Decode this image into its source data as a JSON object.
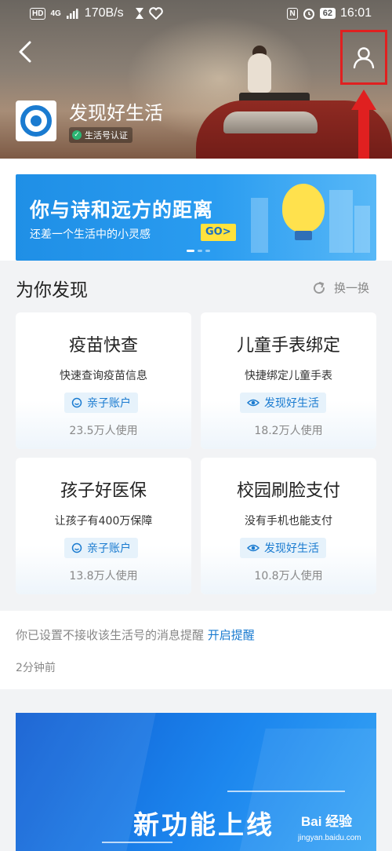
{
  "status_bar": {
    "network_chip": "HD",
    "network_type": "4G",
    "speed": "170B/s",
    "nfc": "N",
    "battery": "62",
    "time": "16:01"
  },
  "header": {
    "app_name": "发现好生活",
    "verify_label": "生活号认证"
  },
  "banner": {
    "title": "你与诗和远方的距离",
    "subtitle": "还差一个生活中的小灵感",
    "cta": "GO>"
  },
  "discover": {
    "title": "为你发现",
    "refresh_label": "换一换",
    "cards": [
      {
        "title": "疫苗快查",
        "desc": "快速查询疫苗信息",
        "tag": "亲子账户",
        "tag_icon": "smile-icon",
        "users": "23.5万人使用"
      },
      {
        "title": "儿童手表绑定",
        "desc": "快捷绑定儿童手表",
        "tag": "发现好生活",
        "tag_icon": "eye-icon",
        "users": "18.2万人使用"
      },
      {
        "title": "孩子好医保",
        "desc": "让孩子有400万保障",
        "tag": "亲子账户",
        "tag_icon": "smile-icon",
        "users": "13.8万人使用"
      },
      {
        "title": "校园刷脸支付",
        "desc": "没有手机也能支付",
        "tag": "发现好生活",
        "tag_icon": "eye-icon",
        "users": "10.8万人使用"
      }
    ]
  },
  "notice": {
    "text": "你已设置不接收该生活号的消息提醒",
    "link": "开启提醒",
    "time": "2分钟前"
  },
  "feature": {
    "title": "新功能上线"
  },
  "watermark": {
    "brand": "Bai 经验",
    "url": "jingyan.baidu.com"
  },
  "colors": {
    "accent": "#1a7bd0",
    "highlight_red": "#e02020",
    "banner_yellow": "#ffe23d"
  }
}
